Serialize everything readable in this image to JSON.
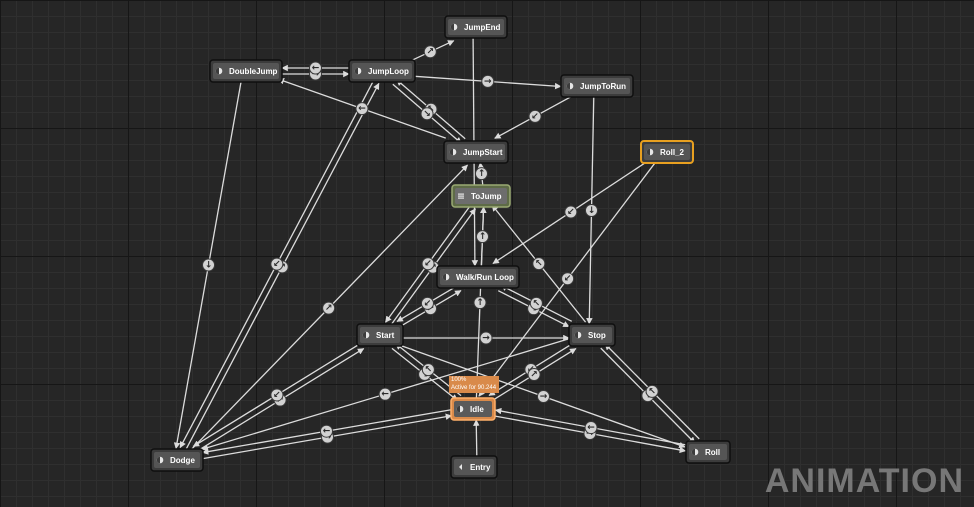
{
  "graph": {
    "nodes": [
      {
        "id": "JumpEnd",
        "label": "JumpEnd",
        "kind": "state"
      },
      {
        "id": "DoubleJump",
        "label": "DoubleJump",
        "kind": "state"
      },
      {
        "id": "JumpLoop",
        "label": "JumpLoop",
        "kind": "state"
      },
      {
        "id": "JumpToRun",
        "label": "JumpToRun",
        "kind": "state"
      },
      {
        "id": "JumpStart",
        "label": "JumpStart",
        "kind": "state"
      },
      {
        "id": "Roll_2",
        "label": "Roll_2",
        "kind": "state",
        "selected": true
      },
      {
        "id": "ToJump",
        "label": "ToJump",
        "kind": "conduit"
      },
      {
        "id": "WalkRun",
        "label": "Walk/Run Loop",
        "kind": "state"
      },
      {
        "id": "Start",
        "label": "Start",
        "kind": "state"
      },
      {
        "id": "Stop",
        "label": "Stop",
        "kind": "state"
      },
      {
        "id": "Idle",
        "label": "Idle",
        "kind": "state",
        "active": true
      },
      {
        "id": "Dodge",
        "label": "Dodge",
        "kind": "state"
      },
      {
        "id": "Roll",
        "label": "Roll",
        "kind": "state"
      },
      {
        "id": "Entry",
        "label": "Entry",
        "kind": "entry"
      }
    ],
    "edges": [
      [
        "DoubleJump",
        "JumpLoop"
      ],
      [
        "JumpLoop",
        "DoubleJump"
      ],
      [
        "JumpLoop",
        "JumpEnd"
      ],
      [
        "JumpLoop",
        "JumpToRun"
      ],
      [
        "JumpEnd",
        "WalkRun"
      ],
      [
        "JumpToRun",
        "JumpStart"
      ],
      [
        "JumpStart",
        "DoubleJump"
      ],
      [
        "JumpStart",
        "JumpLoop"
      ],
      [
        "JumpLoop",
        "JumpStart"
      ],
      [
        "ToJump",
        "JumpStart"
      ],
      [
        "Idle",
        "ToJump"
      ],
      [
        "WalkRun",
        "ToJump"
      ],
      [
        "Start",
        "ToJump"
      ],
      [
        "ToJump",
        "Start"
      ],
      [
        "Stop",
        "ToJump"
      ],
      [
        "Roll_2",
        "WalkRun"
      ],
      [
        "Roll_2",
        "Idle"
      ],
      [
        "JumpToRun",
        "Stop"
      ],
      [
        "WalkRun",
        "Stop"
      ],
      [
        "Stop",
        "WalkRun"
      ],
      [
        "Start",
        "WalkRun"
      ],
      [
        "WalkRun",
        "Start"
      ],
      [
        "Start",
        "Stop"
      ],
      [
        "Start",
        "Idle"
      ],
      [
        "Idle",
        "Start"
      ],
      [
        "Stop",
        "Idle"
      ],
      [
        "Idle",
        "Stop"
      ],
      [
        "Stop",
        "Roll"
      ],
      [
        "Roll",
        "Stop"
      ],
      [
        "Idle",
        "Roll"
      ],
      [
        "Roll",
        "Idle"
      ],
      [
        "Start",
        "Roll"
      ],
      [
        "Dodge",
        "Idle"
      ],
      [
        "Idle",
        "Dodge"
      ],
      [
        "Dodge",
        "Start"
      ],
      [
        "Start",
        "Dodge"
      ],
      [
        "Dodge",
        "JumpLoop"
      ],
      [
        "JumpLoop",
        "Dodge"
      ],
      [
        "DoubleJump",
        "Dodge"
      ],
      [
        "Dodge",
        "JumpStart"
      ],
      [
        "Stop",
        "Dodge"
      ],
      [
        "Entry",
        "Idle"
      ]
    ]
  },
  "active_badge": {
    "line1": "100%",
    "line2": "Active for 90.244"
  },
  "watermark": "ANIMATION"
}
